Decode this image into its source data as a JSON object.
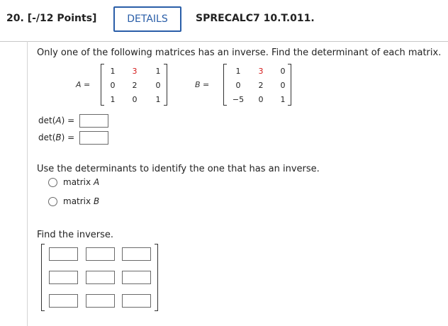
{
  "header": {
    "question_number": "20.",
    "points": "[-/12 Points]",
    "details_button": "DETAILS",
    "code": "SPRECALC7 10.T.011."
  },
  "prompt": "Only one of the following matrices has an inverse. Find the determinant of each matrix.",
  "matrix_a": {
    "name": "A",
    "equals": "=",
    "rows": [
      [
        "1",
        "3",
        "1"
      ],
      [
        "0",
        "2",
        "0"
      ],
      [
        "1",
        "0",
        "1"
      ]
    ],
    "highlight_color": "#d41a1a"
  },
  "matrix_b": {
    "name": "B",
    "equals": "=",
    "rows": [
      [
        "1",
        "3",
        "0"
      ],
      [
        "0",
        "2",
        "0"
      ],
      [
        "−5",
        "0",
        "1"
      ]
    ],
    "highlight_color": "#d41a1a"
  },
  "determinants": {
    "a_label_pre": "det(",
    "a_label_var": "A",
    "a_label_post": ") =",
    "a_value": "",
    "b_label_pre": "det(",
    "b_label_var": "B",
    "b_label_post": ") =",
    "b_value": ""
  },
  "inverse_question": "Use the determinants to identify the one that has an inverse.",
  "options": [
    {
      "prefix": "matrix ",
      "var": "A"
    },
    {
      "prefix": "matrix ",
      "var": "B"
    }
  ],
  "find_inverse": "Find the inverse.",
  "inverse_entries": [
    [
      "",
      "",
      ""
    ],
    [
      "",
      "",
      ""
    ],
    [
      "",
      "",
      ""
    ]
  ],
  "colors": {
    "accent": "#2a5ea8",
    "highlight": "#d41a1a"
  }
}
